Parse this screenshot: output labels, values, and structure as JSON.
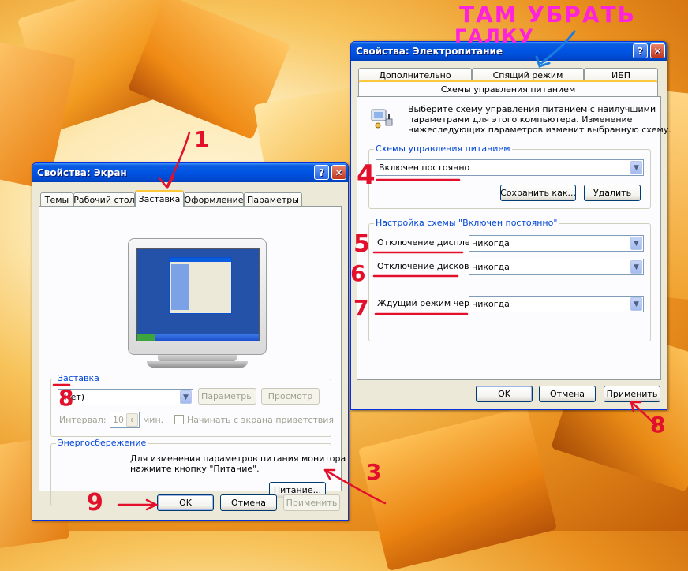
{
  "display_window": {
    "title": "Свойства: Экран",
    "help_button": "?",
    "close_button": "✕",
    "tabs": [
      "Темы",
      "Рабочий стол",
      "Заставка",
      "Оформление",
      "Параметры"
    ],
    "active_tab": "Заставка",
    "screensaver_group": {
      "label": "Заставка",
      "selected": "(Нет)",
      "params_button": "Параметры",
      "preview_button": "Просмотр",
      "interval_label": "Интервал:",
      "interval_value": "10",
      "minutes_label": "мин.",
      "welcome_checkbox": "Начинать с экрана приветствия"
    },
    "power_group": {
      "label": "Энергосбережение",
      "text_line1": "Для изменения параметров питания монитора",
      "text_line2": "нажмите кнопку \"Питание\".",
      "power_button": "Питание..."
    },
    "ok_button": "OK",
    "cancel_button": "Отмена",
    "apply_button": "Применить"
  },
  "power_window": {
    "title": "Свойства: Электропитание",
    "help_button": "?",
    "close_button": "✕",
    "tabs_top": [
      "Дополнительно",
      "Спящий режим",
      "ИБП"
    ],
    "active_tab": "Схемы управления питанием",
    "intro_line1": "Выберите схему управления питанием с наилучшими",
    "intro_line2": "параметрами для этого компьютера. Изменение",
    "intro_line3": "нижеследующих параметров изменит выбранную схему.",
    "schemes_group": {
      "label": "Схемы управления питанием",
      "selected": "Включен постоянно",
      "save_button": "Сохранить как...",
      "delete_button": "Удалить"
    },
    "settings_group": {
      "label": "Настройка схемы \"Включен постоянно\"",
      "display_off_label": "Отключение дисплея:",
      "display_off_value": "никогда",
      "disks_off_label": "Отключение дисков:",
      "disks_off_value": "никогда",
      "standby_label": "Ждущий режим через:",
      "standby_value": "никогда"
    },
    "ok_button": "OK",
    "cancel_button": "Отмена",
    "apply_button": "Применить"
  },
  "annotations": {
    "note_line1": "ТАМ УБРАТЬ",
    "note_line2": "ГАЛКУ",
    "n1": "1",
    "n3": "3",
    "n4": "4",
    "n5": "5",
    "n6": "6",
    "n7": "7",
    "n8": "8",
    "n9": "9"
  },
  "colors": {
    "annotation_red": "#e2102a",
    "annotation_pink": "#ff22dd",
    "annotation_blue": "#1a7be0",
    "xp_title_blue": "#0054e3",
    "dialog_bg": "#ece9d8"
  }
}
